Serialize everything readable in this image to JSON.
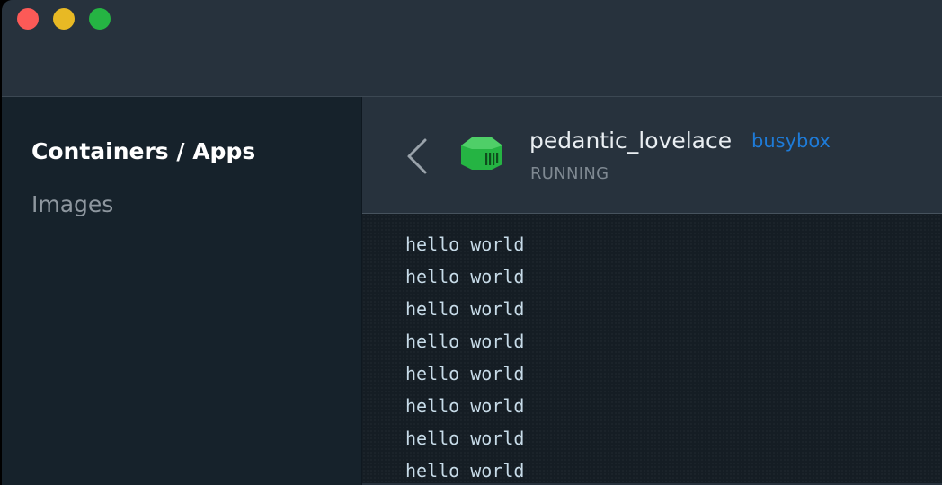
{
  "window": {
    "traffic_lights": {
      "close_color": "#fc5a57",
      "minimize_color": "#e8b924",
      "maximize_color": "#25b443"
    }
  },
  "sidebar": {
    "items": [
      {
        "label": "Containers / Apps",
        "active": true
      },
      {
        "label": "Images",
        "active": false
      }
    ]
  },
  "container": {
    "name": "pedantic_lovelace",
    "image": "busybox",
    "status": "RUNNING",
    "icon": "container-icon",
    "icon_color": "#25b443",
    "image_link_color": "#1e7bd8"
  },
  "logs": {
    "lines": [
      "hello world",
      "hello world",
      "hello world",
      "hello world",
      "hello world",
      "hello world",
      "hello world",
      "hello world"
    ]
  }
}
